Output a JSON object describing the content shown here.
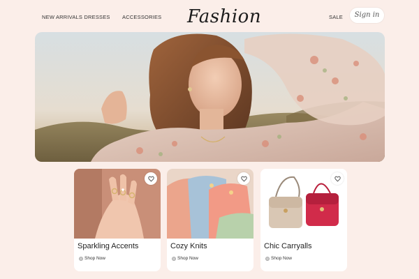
{
  "header": {
    "nav_left": "NEW ARRIVALS DRESSES",
    "nav_accessories": "ACCESSORIES",
    "logo": "Fashion",
    "nav_sale": "SALE",
    "signin": "Sign in"
  },
  "hero": {
    "image": "woman-in-floral-blouse-in-field"
  },
  "cards": [
    {
      "title": "Sparkling Accents",
      "link": "Shop Now",
      "image": "hands-with-rings",
      "icon": "heart-icon"
    },
    {
      "title": "Cozy Knits",
      "link": "Shop Now",
      "image": "folded-pastel-sweaters",
      "icon": "heart-icon"
    },
    {
      "title": "Chic Carryalls",
      "link": "Shop Now",
      "image": "beige-and-red-handbags",
      "icon": "heart-icon"
    }
  ],
  "colors": {
    "background": "#fbeee9",
    "card": "#ffffff",
    "text": "#222222"
  }
}
